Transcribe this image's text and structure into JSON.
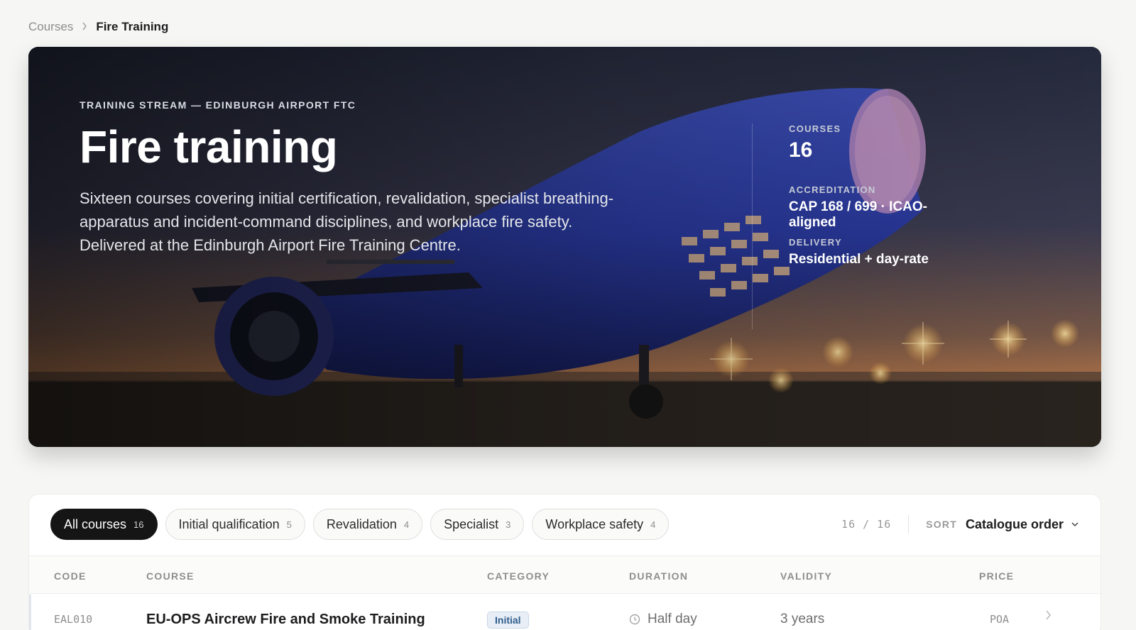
{
  "breadcrumb": {
    "parent": "Courses",
    "current": "Fire Training"
  },
  "hero": {
    "eyebrow": "TRAINING STREAM — EDINBURGH AIRPORT FTC",
    "title": "Fire training",
    "description": "Sixteen courses covering initial certification, revalidation, specialist breathing-apparatus and incident-command disciplines, and workplace fire safety. Delivered at the Edinburgh Airport Fire Training Centre.",
    "stats": [
      {
        "label": "COURSES",
        "value": "16"
      },
      {
        "label": "ACCREDITATION",
        "value": "CAP 168 / 699 · ICAO-aligned"
      },
      {
        "label": "DELIVERY",
        "value": "Residential + day-rate"
      }
    ]
  },
  "filters": [
    {
      "label": "All courses",
      "count": "16",
      "active": true
    },
    {
      "label": "Initial qualification",
      "count": "5",
      "active": false
    },
    {
      "label": "Revalidation",
      "count": "4",
      "active": false
    },
    {
      "label": "Specialist",
      "count": "3",
      "active": false
    },
    {
      "label": "Workplace safety",
      "count": "4",
      "active": false
    }
  ],
  "results": {
    "shown": "16",
    "separator": "/",
    "total": "16"
  },
  "sort": {
    "label": "SORT",
    "value": "Catalogue order"
  },
  "table": {
    "headers": {
      "code": "CODE",
      "course": "COURSE",
      "category": "CATEGORY",
      "duration": "DURATION",
      "validity": "VALIDITY",
      "price": "PRICE"
    },
    "rows": [
      {
        "code": "EAL010",
        "course": "EU-OPS Aircrew Fire and Smoke Training",
        "category": "Initial",
        "duration": "Half day",
        "validity": "3 years",
        "price": "POA"
      }
    ]
  },
  "icons": {
    "breadcrumb_separator": "chevron-right-icon",
    "sort_dropdown": "chevron-down-icon",
    "duration": "clock-icon",
    "row_open": "chevron-right-icon"
  },
  "colors": {
    "page_background": "#f6f6f4",
    "active_chip": "#151515",
    "category_badge_bg": "#e8eef6",
    "category_badge_text": "#2f5e8e"
  }
}
